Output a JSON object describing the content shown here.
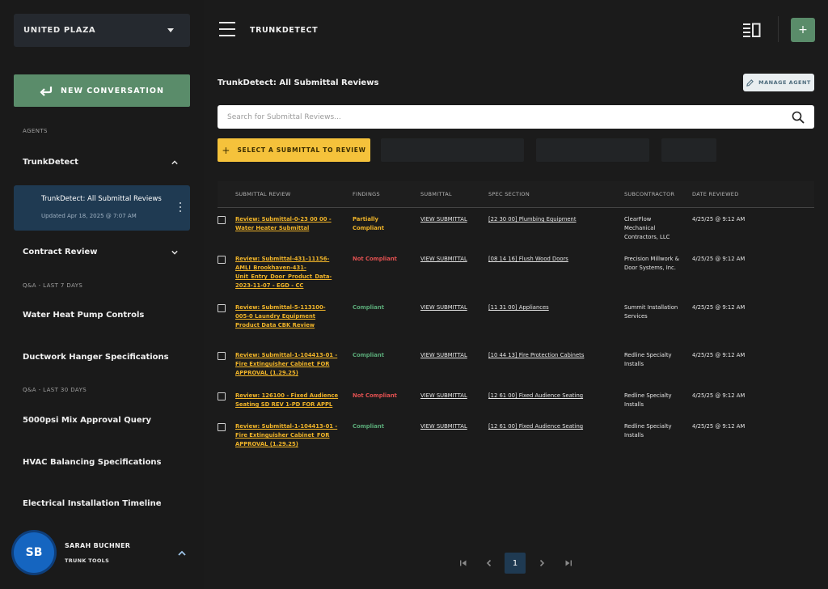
{
  "sidebar": {
    "project": "UNITED PLAZA",
    "new_conversation": "NEW CONVERSATION",
    "agents_label": "AGENTS",
    "agent_group": "TrunkDetect",
    "active_item": {
      "title": "TrunkDetect: All Submittal Reviews",
      "updated": "Updated Apr 18, 2025 @ 7:07 AM"
    },
    "contract_review": "Contract Review",
    "qa_7_label": "Q&A - LAST 7 DAYS",
    "qa_7_items": [
      "Water Heat Pump Controls",
      "Ductwork Hanger Specifications"
    ],
    "qa_30_label": "Q&A - LAST 30 DAYS",
    "qa_30_items": [
      "5000psi Mix Approval Query",
      "HVAC Balancing Specifications",
      "Electrical Installation Timeline"
    ]
  },
  "user": {
    "initials": "SB",
    "name": "SARAH BUCHNER",
    "org": "TRUNK TOOLS",
    "avatar_color": "#1565c0"
  },
  "topbar": {
    "app_title": "TRUNKDETECT",
    "plus_label": "+"
  },
  "main": {
    "title": "TrunkDetect: All Submittal Reviews",
    "manage_agent": "MANAGE AGENT",
    "search_placeholder": "Search for Submittal Reviews...",
    "select_submittal": "SELECT A SUBMITTAL TO REVIEW"
  },
  "table": {
    "headers": [
      "SUBMITTAL REVIEW",
      "FINDINGS",
      "SUBMITTAL",
      "SPEC SECTION",
      "SUBCONTRACTOR",
      "DATE REVIEWED"
    ],
    "rows": [
      {
        "review": "Review: Submittal-0-23 00 00 - Water Heater Submittal",
        "findings": "Partially Compliant",
        "status": "partial",
        "submittal": "VIEW SUBMITTAL",
        "spec": "[22 30 00] Plumbing Equipment",
        "sub": "ClearFlow Mechanical Contractors, LLC",
        "date": "4/25/25 @ 9:12 AM"
      },
      {
        "review": "Review: Submittal-431-11156-AMLI_Brookhaven-431-Unit_Entry_Door_Product_Data-2023-11-07 - EGD - CC",
        "findings": "Not Compliant",
        "status": "not",
        "submittal": "VIEW SUBMITTAL",
        "spec": "[08 14 16] Flush Wood Doors",
        "sub": "Precision Millwork & Door Systems, Inc.",
        "date": "4/25/25 @ 9:12 AM"
      },
      {
        "review": "Review: Submittal-5-113100-005-0 Laundry Equipment Product Data CBK Review",
        "findings": "Compliant",
        "status": "ok",
        "submittal": "VIEW SUBMITTAL",
        "spec": "[11 31 00] Appliances",
        "sub": "Summit Installation Services",
        "date": "4/25/25 @ 9:12 AM"
      },
      {
        "review": "Review: Submittal-1-104413-01 - Fire Extinguisher Cabinet_FOR APPROVAL (1.29.25)",
        "findings": "Compliant",
        "status": "ok",
        "submittal": "VIEW SUBMITTAL",
        "spec": "[10 44 13] Fire Protection Cabinets",
        "sub": "Redline Specialty Installs",
        "date": "4/25/25 @ 9:12 AM"
      },
      {
        "review": "Review: 126100 - Fixed Audience Seating SD REV 1-PD FOR APPL",
        "findings": "Not Compliant",
        "status": "not",
        "submittal": "VIEW SUBMITTAL",
        "spec": "[12 61 00] Fixed Audience Seating",
        "sub": "Redline Specialty Installs",
        "date": "4/25/25 @ 9:12 AM"
      },
      {
        "review": "Review: Submittal-1-104413-01 - Fire Extinguisher Cabinet_FOR APPROVAL (1.29.25)",
        "findings": "Compliant",
        "status": "ok",
        "submittal": "VIEW SUBMITTAL",
        "spec": "[12 61 00] Fixed Audience Seating",
        "sub": "Redline Specialty Installs",
        "date": "4/25/25 @ 9:12 AM"
      }
    ]
  },
  "pagination": {
    "current_page": "1"
  },
  "colors": {
    "accent_green": "#5a8c6a",
    "accent_yellow": "#f5c23b",
    "active_blue": "#1f3a52",
    "compliant": "#5aaa78",
    "not_compliant": "#e05050",
    "partial": "#f0b429"
  },
  "icons": {
    "project_dropdown": "caret-down-icon",
    "new_conversation": "reply-arrow-icon",
    "menu": "hamburger-icon",
    "panel": "panel-layout-icon",
    "search": "search-icon",
    "manage": "pencil-icon"
  }
}
